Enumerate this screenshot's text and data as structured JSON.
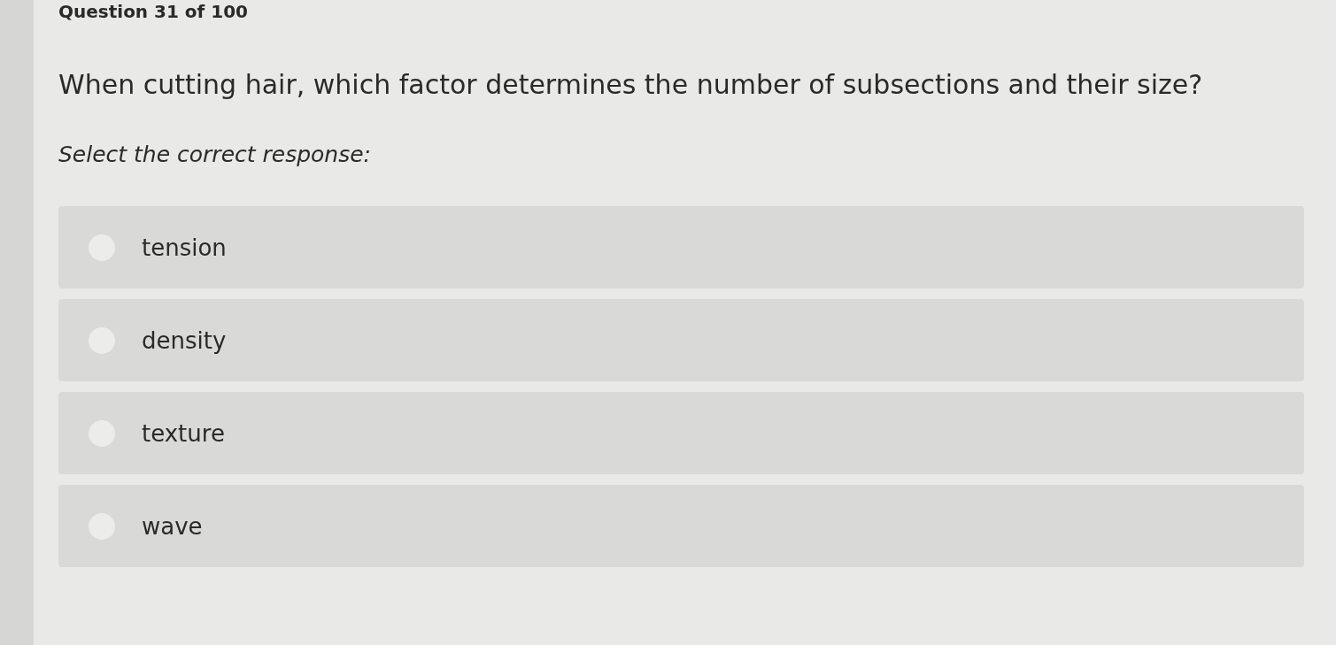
{
  "header": {
    "title": "Question 31 of 100"
  },
  "question": {
    "text": "When cutting hair, which factor determines the number of subsections and their size?",
    "instruction": "Select the correct response:"
  },
  "options": [
    {
      "label": "tension",
      "selected": false
    },
    {
      "label": "density",
      "selected": false
    },
    {
      "label": "texture",
      "selected": false
    },
    {
      "label": "wave",
      "selected": false
    }
  ]
}
